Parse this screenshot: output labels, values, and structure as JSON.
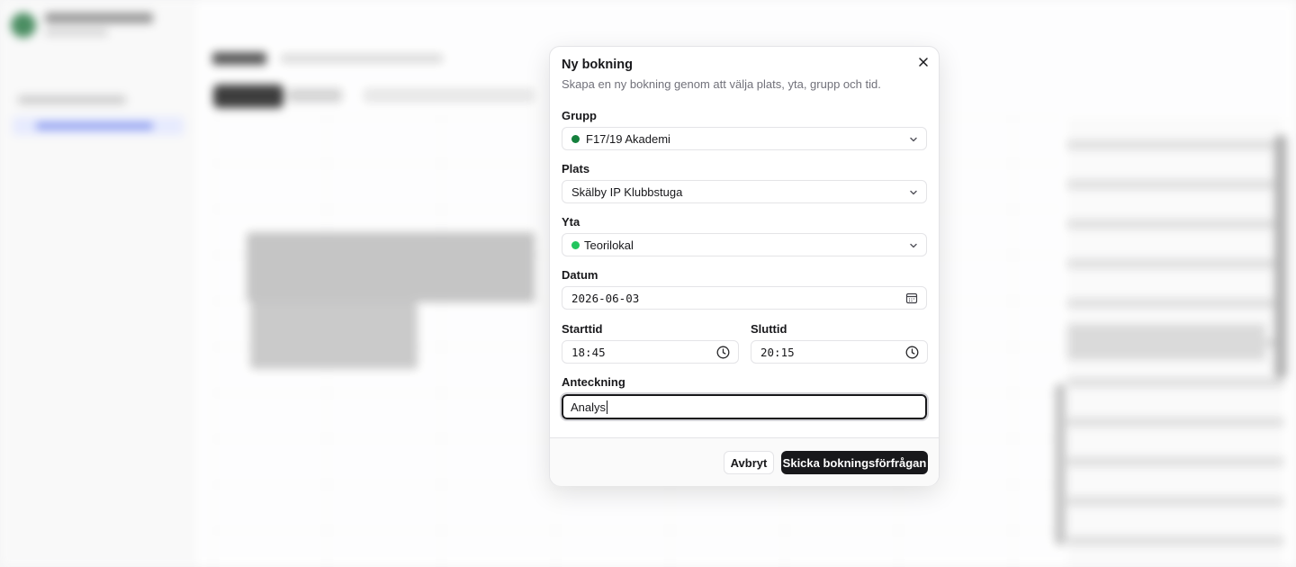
{
  "dialog": {
    "title": "Ny bokning",
    "description": "Skapa en ny bokning genom att välja plats, yta, grupp och tid.",
    "close_icon": "close-icon"
  },
  "form": {
    "group": {
      "label": "Grupp",
      "value": "F17/19 Akademi",
      "dot_color": "#15803d"
    },
    "location": {
      "label": "Plats",
      "value": "Skälby IP Klubbstuga"
    },
    "area": {
      "label": "Yta",
      "value": "Teorilokal",
      "dot_color": "#22c55e"
    },
    "date": {
      "label": "Datum",
      "value": "2026-06-03",
      "icon": "calendar-icon"
    },
    "start": {
      "label": "Starttid",
      "value": "18:45",
      "icon": "clock-icon"
    },
    "end": {
      "label": "Sluttid",
      "value": "20:15",
      "icon": "clock-icon"
    },
    "note": {
      "label": "Anteckning",
      "value": "Analys"
    }
  },
  "footer": {
    "cancel_label": "Avbryt",
    "submit_label": "Skicka bokningsförfrågan"
  }
}
